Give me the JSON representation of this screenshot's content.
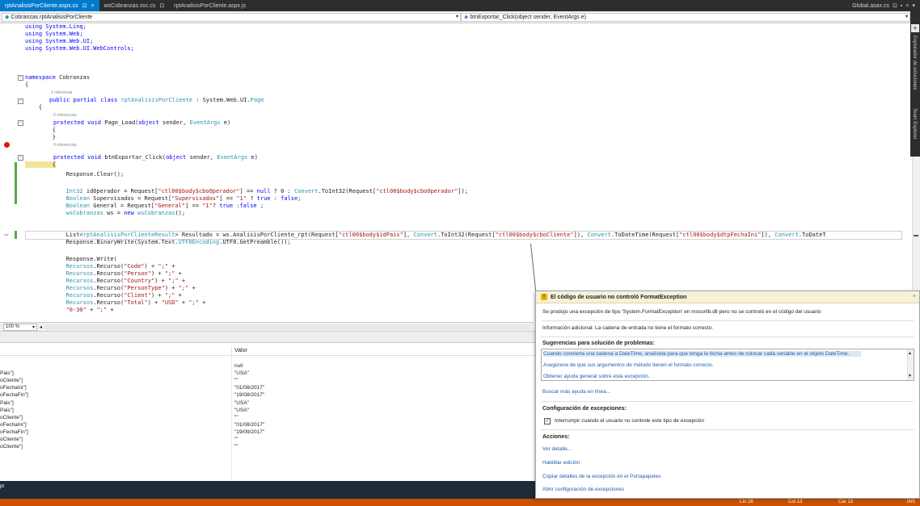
{
  "tabs": [
    {
      "label": "rptAnalisisPorCliente.aspx.cs",
      "active": true,
      "pin": "⊡",
      "close": "×"
    },
    {
      "label": "wsCobranzas.svc.cs",
      "active": false,
      "pin": "⊡"
    },
    {
      "label": "rptAnalisisPorCliente.aspx.js",
      "active": false
    }
  ],
  "tab_right": {
    "label": "Global.asax.cs",
    "pin": "⊡",
    "extra": "▪",
    "close": "×",
    "menu": "▾"
  },
  "nav": {
    "class_dropdown": "Cobranzas.rptAnalisisPorCliente",
    "member_dropdown": "btnExportar_Click(object sender, EventArgs e)"
  },
  "sidebar": {
    "item1": "Explorador de soluciones",
    "item2": "Team Explorer"
  },
  "code": {
    "using1": "using System.Linq;",
    "using2": "using System.Web;",
    "using3": "using System.Web.UI;",
    "using4": "using System.Web.UI.WebControls;",
    "ns_kw": "namespace",
    "ns_name": " Cobranzas",
    "brace_open": "{",
    "ref1": "1 referencia",
    "class_decl_kw": "public partial class",
    "class_name": " rptAnalisisPorCliente",
    "class_sep": " : System.Web.UI.",
    "class_base": "Page",
    "brace_open2": "    {",
    "ref0a": "0 referencias",
    "pageload_kw": "protected void",
    "pageload_rest": " Page_Load(",
    "pageload_obj": "object",
    "pageload_rest2": " sender, ",
    "pageload_ev": "EventArgs",
    "pageload_rest3": " e)",
    "brace3": "        {",
    "brace4": "        }",
    "ref0b": "0 referencias",
    "btn_kw": "protected void",
    "btn_rest": " btnExportar_Click(",
    "btn_obj": "object",
    "btn_rest2": " sender, ",
    "btn_ev": "EventArgs",
    "btn_rest3": " e)",
    "brace5": "        {",
    "resp_clear": "            Response.Clear();",
    "l_int": "            Int32",
    "l_int_rest": " idOperador = Request[",
    "l_int_str": "\"ctl00$body$cboOperador\"",
    "l_int_rest2": "] == ",
    "l_int_null": "null",
    "l_int_rest3": " ? 0 : ",
    "l_int_conv": "Convert",
    "l_int_rest4": ".ToInt32(Request[",
    "l_int_str2": "\"ctl00$body$cboOperador\"",
    "l_int_rest5": "]);",
    "l_bool1": "            Boolean",
    "l_bool1_rest": " Supervisados = Request[",
    "l_bool1_str": "\"Supervisados\"",
    "l_bool1_rest2": "] == ",
    "l_bool1_str2": "\"1\"",
    "l_bool1_rest3": " ? ",
    "l_bool1_true": "true",
    "l_bool1_rest4": " : ",
    "l_bool1_false": "false",
    "l_bool1_rest5": ";",
    "l_bool2": "            Boolean",
    "l_bool2_rest": " General = Request[",
    "l_bool2_str": "\"General\"",
    "l_bool2_rest2": "] == ",
    "l_bool2_str2": "\"1\"",
    "l_bool2_rest3": "? ",
    "l_bool2_true": "true",
    "l_bool2_rest4": " :",
    "l_bool2_false": "false",
    "l_bool2_rest5": " ;",
    "l_ws": "            wsCobranzas",
    "l_ws_rest": " ws = ",
    "l_ws_new": "new",
    "l_ws_type": " wsCobranzas",
    "l_ws_rest2": "();",
    "l_list": "            List<",
    "l_list_type": "rptAnalisisPorClienteResult",
    "l_list_rest": "> Resultado = ws.AnalisisPorCliente_rpt(Request[",
    "l_list_str1": "\"ctl00$body$idPais\"",
    "l_list_rest2": "], ",
    "l_list_conv1": "Convert",
    "l_list_rest3": ".ToInt32(Request[",
    "l_list_str2": "\"ctl00$body$cboCliente\"",
    "l_list_rest4": "]), ",
    "l_list_conv2": "Convert",
    "l_list_rest5": ".ToDateTime(Request[",
    "l_list_str3": "\"ctl00$body$dtpFechaIni\"",
    "l_list_rest6": "]), ",
    "l_list_conv3": "Convert",
    "l_list_rest7": ".ToDateT",
    "l_bin": "            Response.BinaryWrite(System.Text.",
    "l_bin_type": "UTF8Encoding",
    "l_bin_rest": ".UTF8.GetPreamble());",
    "l_write": "            Response.Write(",
    "rec1": "            Recursos",
    "rec1_rest": ".Recurso(",
    "rec1_str": "\"Code\"",
    "rec1_rest2": ") + ",
    "rec1_str2": "\";\"",
    "rec1_rest3": " +",
    "rec2": "            Recursos",
    "rec2_rest": ".Recurso(",
    "rec2_str": "\"Person\"",
    "rec2_rest2": ") + ",
    "rec2_str2": "\";\"",
    "rec2_rest3": " +",
    "rec3": "            Recursos",
    "rec3_rest": ".Recurso(",
    "rec3_str": "\"Country\"",
    "rec3_rest2": ") + ",
    "rec3_str2": "\";\"",
    "rec3_rest3": " +",
    "rec4": "            Recursos",
    "rec4_rest": ".Recurso(",
    "rec4_str": "\"PersonType\"",
    "rec4_rest2": ") + ",
    "rec4_str2": "\";\"",
    "rec4_rest3": " +",
    "rec5": "            Recursos",
    "rec5_rest": ".Recurso(",
    "rec5_str": "\"Client\"",
    "rec5_rest2": ") + ",
    "rec5_str2": "\";\"",
    "rec5_rest3": " +",
    "rec6": "            Recursos",
    "rec6_rest": ".Recurso(",
    "rec6_str": "\"Total\"",
    "rec6_rest2": ") + ",
    "rec6_str2": "\"USD\"",
    "rec6_rest3": " + ",
    "rec6_str3": "\";\"",
    "rec6_rest4": " +",
    "rec7_str": "            \"0-30\"",
    "rec7_rest": " + ",
    "rec7_str2": "\";\"",
    "rec7_rest2": " +"
  },
  "zoom": {
    "value": "100 %",
    "dd": "▾",
    "arrow": "◂"
  },
  "watch": {
    "value_header": "Valor",
    "rows": [
      {
        "name": "",
        "value": "null"
      },
      {
        "name": "Pais\"]",
        "value": "\"USA\""
      },
      {
        "name": "oCliente\"]",
        "value": "\"\""
      },
      {
        "name": "oFechaIni\"]",
        "value": "\"01/08/2017\""
      },
      {
        "name": "oFechaFin\"]",
        "value": "\"19/08/2017\""
      },
      {
        "name": "Pais\"]",
        "value": "\"USA\""
      },
      {
        "name": "Pais\"]",
        "value": "\"USA\""
      },
      {
        "name": "oCliente\"]",
        "value": "\"\""
      },
      {
        "name": "oFechaIni\"]",
        "value": "\"01/08/2017\""
      },
      {
        "name": "oFechaFin\"]",
        "value": "\"19/09/2017\""
      },
      {
        "name": "oCliente\"]",
        "value": "\"\""
      },
      {
        "name": "oCliente\"]",
        "value": "\"\""
      }
    ]
  },
  "bottom_panel_label": "pt",
  "status": {
    "ln": "Lín 26",
    "col": "Col 13",
    "car": "Car 13",
    "mode": "INS"
  },
  "popup": {
    "icon": "!",
    "title": "El código de usuario no controló FormatException",
    "close": "×",
    "desc": "Se produjo una excepción de tipo 'System.FormatException' en mscorlib.dll pero no se controló en el código del usuario",
    "info": "Información adicional: La cadena de entrada no tiene el formato correcto.",
    "suggestions_title": "Sugerencias para solución de problemas:",
    "suggestions": [
      "Cuando convierta una cadena a DateTime, analícela para que tenga la fecha antes de colocar cada variable en el objeto DateTime.",
      "Asegúrese de que sus argumentos de método tienen el formato correcto.",
      "Obtener ayuda general sobre esta excepción."
    ],
    "scroll_up": "▴",
    "scroll_down": "▾",
    "more_help": "Buscar más ayuda en línea...",
    "exc_config_title": "Configuración de excepciones:",
    "checkbox_label": "Interrumpir cuando el usuario no controle este tipo de excepción",
    "checkbox_mark": "✓",
    "actions_title": "Acciones:",
    "actions": [
      "Ver detalle...",
      "Habilitar edición",
      "Copiar detalles de la excepción en el Portapapeles",
      "Abrir configuración de excepciones"
    ]
  },
  "colors": {
    "accent": "#007acc",
    "status": "#ca5100",
    "breakpoint": "#e51400",
    "keyword": "#0000ff",
    "type": "#2b91af",
    "string": "#a31515"
  }
}
